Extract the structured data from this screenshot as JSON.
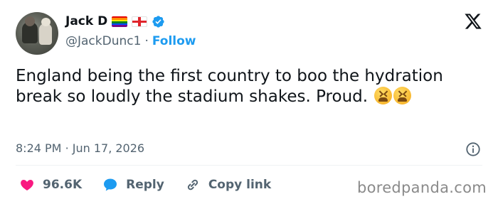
{
  "author": {
    "display_name": "Jack D",
    "handle": "@JackDunc1",
    "separator": "·",
    "follow_label": "Follow"
  },
  "tweet": {
    "text": "England being the first country to boo the hydration break so loudly the stadium shakes. Proud.",
    "time": "8:24 PM",
    "date_separator": "·",
    "date": "Jun 17, 2026"
  },
  "actions": {
    "likes": "96.6K",
    "reply_label": "Reply",
    "copy_link_label": "Copy link"
  },
  "watermark": "boredpanda.com",
  "icons": {
    "brand": "x-logo-icon",
    "verified": "verified-badge-icon",
    "info": "info-icon",
    "like": "heart-icon",
    "reply": "speech-bubble-icon",
    "copy_link": "link-icon",
    "emoji": "tired-face-emoji"
  },
  "colors": {
    "accent": "#1d9bf0",
    "text": "#0f1419",
    "secondary": "#536471",
    "like": "#f91880"
  }
}
